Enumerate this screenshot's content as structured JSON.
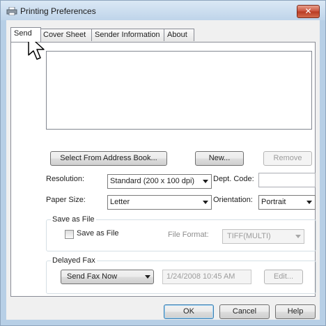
{
  "window": {
    "title": "Printing Preferences",
    "close_label": "✕"
  },
  "tabs": [
    {
      "label": "Send",
      "active": true
    },
    {
      "label": "Cover Sheet",
      "active": false
    },
    {
      "label": "Sender Information",
      "active": false
    },
    {
      "label": "About",
      "active": false
    }
  ],
  "send": {
    "recipient_list": [],
    "buttons": {
      "select_address_book": "Select From Address Book...",
      "new": "New...",
      "remove": "Remove"
    },
    "resolution": {
      "label": "Resolution:",
      "value": "Standard (200 x 100 dpi)"
    },
    "dept_code": {
      "label": "Dept. Code:",
      "value": ""
    },
    "paper_size": {
      "label": "Paper Size:",
      "value": "Letter"
    },
    "orientation": {
      "label": "Orientation:",
      "value": "Portrait"
    },
    "save_as_file": {
      "group_title": "Save as File",
      "checkbox_label": "Save as File",
      "checked": false,
      "file_format_label": "File Format:",
      "file_format_value": "TIFF(MULTI)"
    },
    "delayed_fax": {
      "group_title": "Delayed Fax",
      "mode_value": "Send Fax Now",
      "datetime_value": "1/24/2008 10:45 AM",
      "edit_label": "Edit..."
    }
  },
  "footer": {
    "ok_label": "OK",
    "cancel_label": "Cancel",
    "help_label": "Help"
  }
}
